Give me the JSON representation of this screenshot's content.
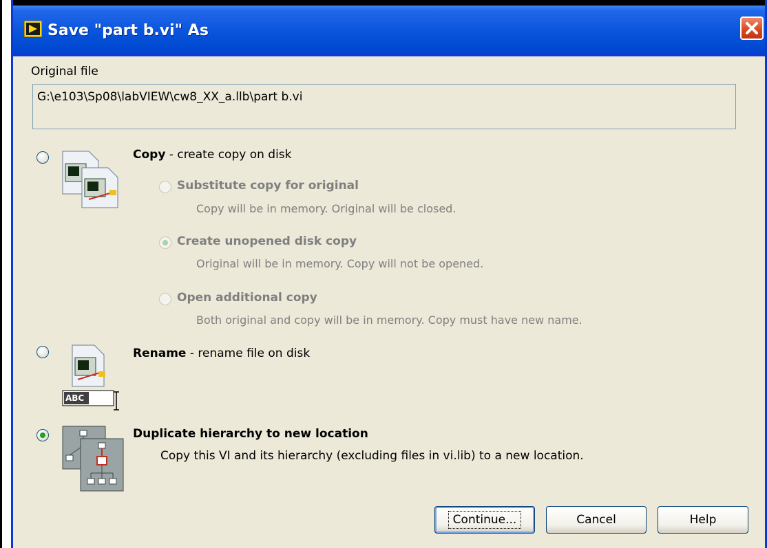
{
  "window": {
    "title": "Save \"part b.vi\" As"
  },
  "original_file": {
    "label": "Original file",
    "path": "G:\\e103\\Sp08\\labVIEW\\cw8_XX_a.llb\\part b.vi"
  },
  "options": {
    "copy": {
      "title": "Copy",
      "desc": " - create copy on disk",
      "selected": false,
      "sub_options": [
        {
          "title": "Substitute copy for original",
          "desc": "Copy will be in memory. Original will be closed.",
          "selected": false
        },
        {
          "title": "Create unopened disk copy",
          "desc": "Original will be in memory. Copy will not be opened.",
          "selected": true
        },
        {
          "title": "Open additional copy",
          "desc": "Both original and copy will be in memory. Copy must have new name.",
          "selected": false
        }
      ]
    },
    "rename": {
      "title": "Rename",
      "desc": " - rename file on disk",
      "selected": false,
      "icon_text": "ABC"
    },
    "duplicate": {
      "title": "Duplicate hierarchy to new location",
      "desc": "Copy this VI and its hierarchy (excluding files in vi.lib) to a new location.",
      "selected": true
    }
  },
  "buttons": {
    "continue": "Continue...",
    "cancel": "Cancel",
    "help": "Help"
  },
  "colors": {
    "titlebar": "#0a55dd",
    "dialog_bg": "#ece9d8",
    "radio_selected": "#21a121",
    "disabled_text": "#7f7f7f"
  },
  "icons": [
    "labview-app-icon",
    "close-icon",
    "copy-vi-icon",
    "rename-vi-icon",
    "hierarchy-icon"
  ]
}
